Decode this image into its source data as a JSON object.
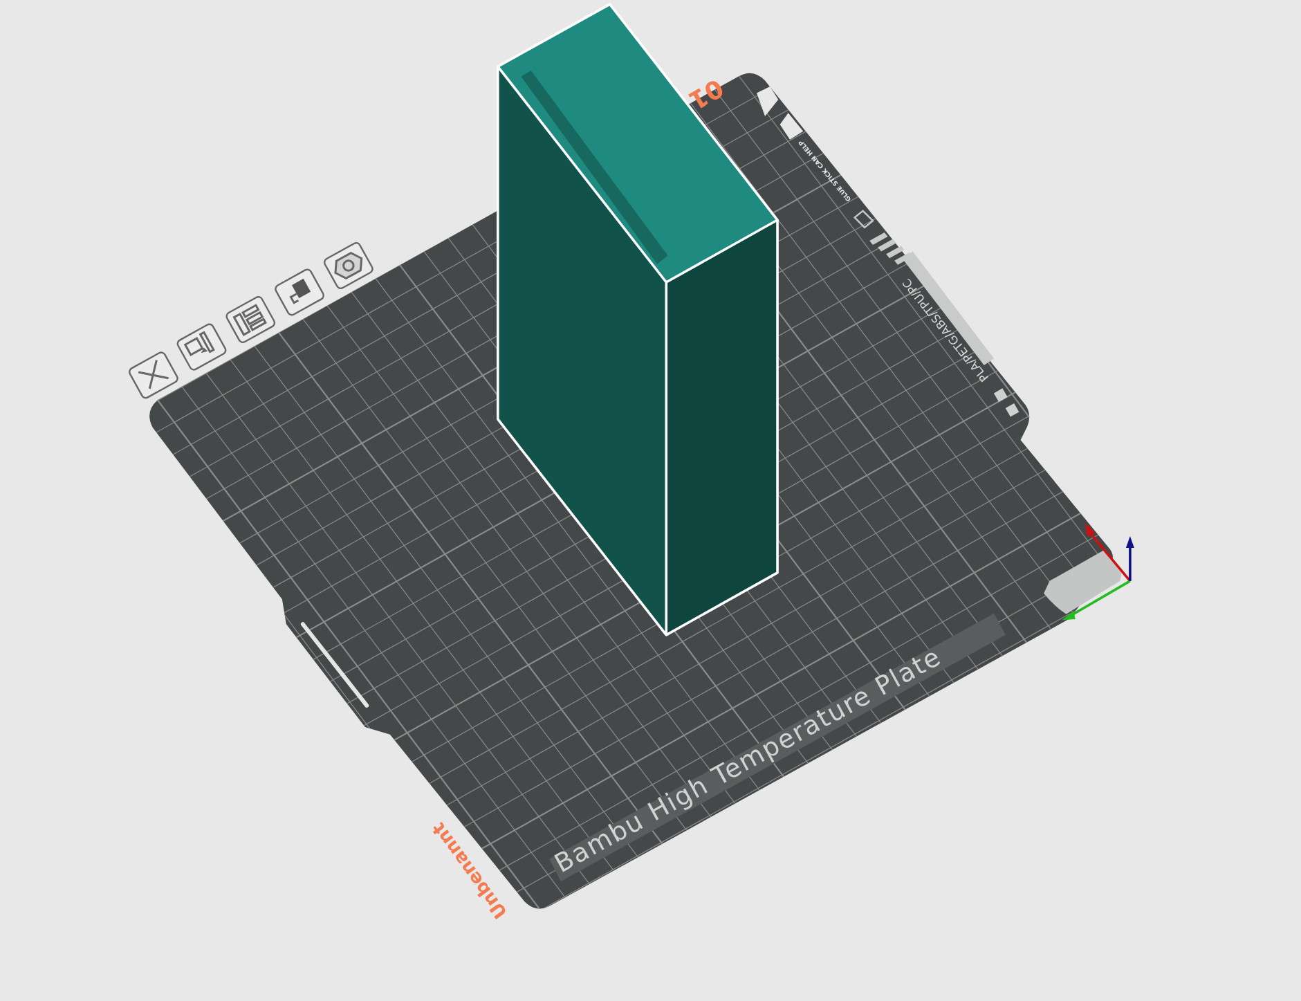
{
  "plate": {
    "number": "01",
    "name": "Bambu High Temperature Plate",
    "project_name": "Unbenannt",
    "material_strip": "PLA/PETG/ABS/TPU/PC",
    "hint": "GLUE STICK CAN HELP"
  }
}
